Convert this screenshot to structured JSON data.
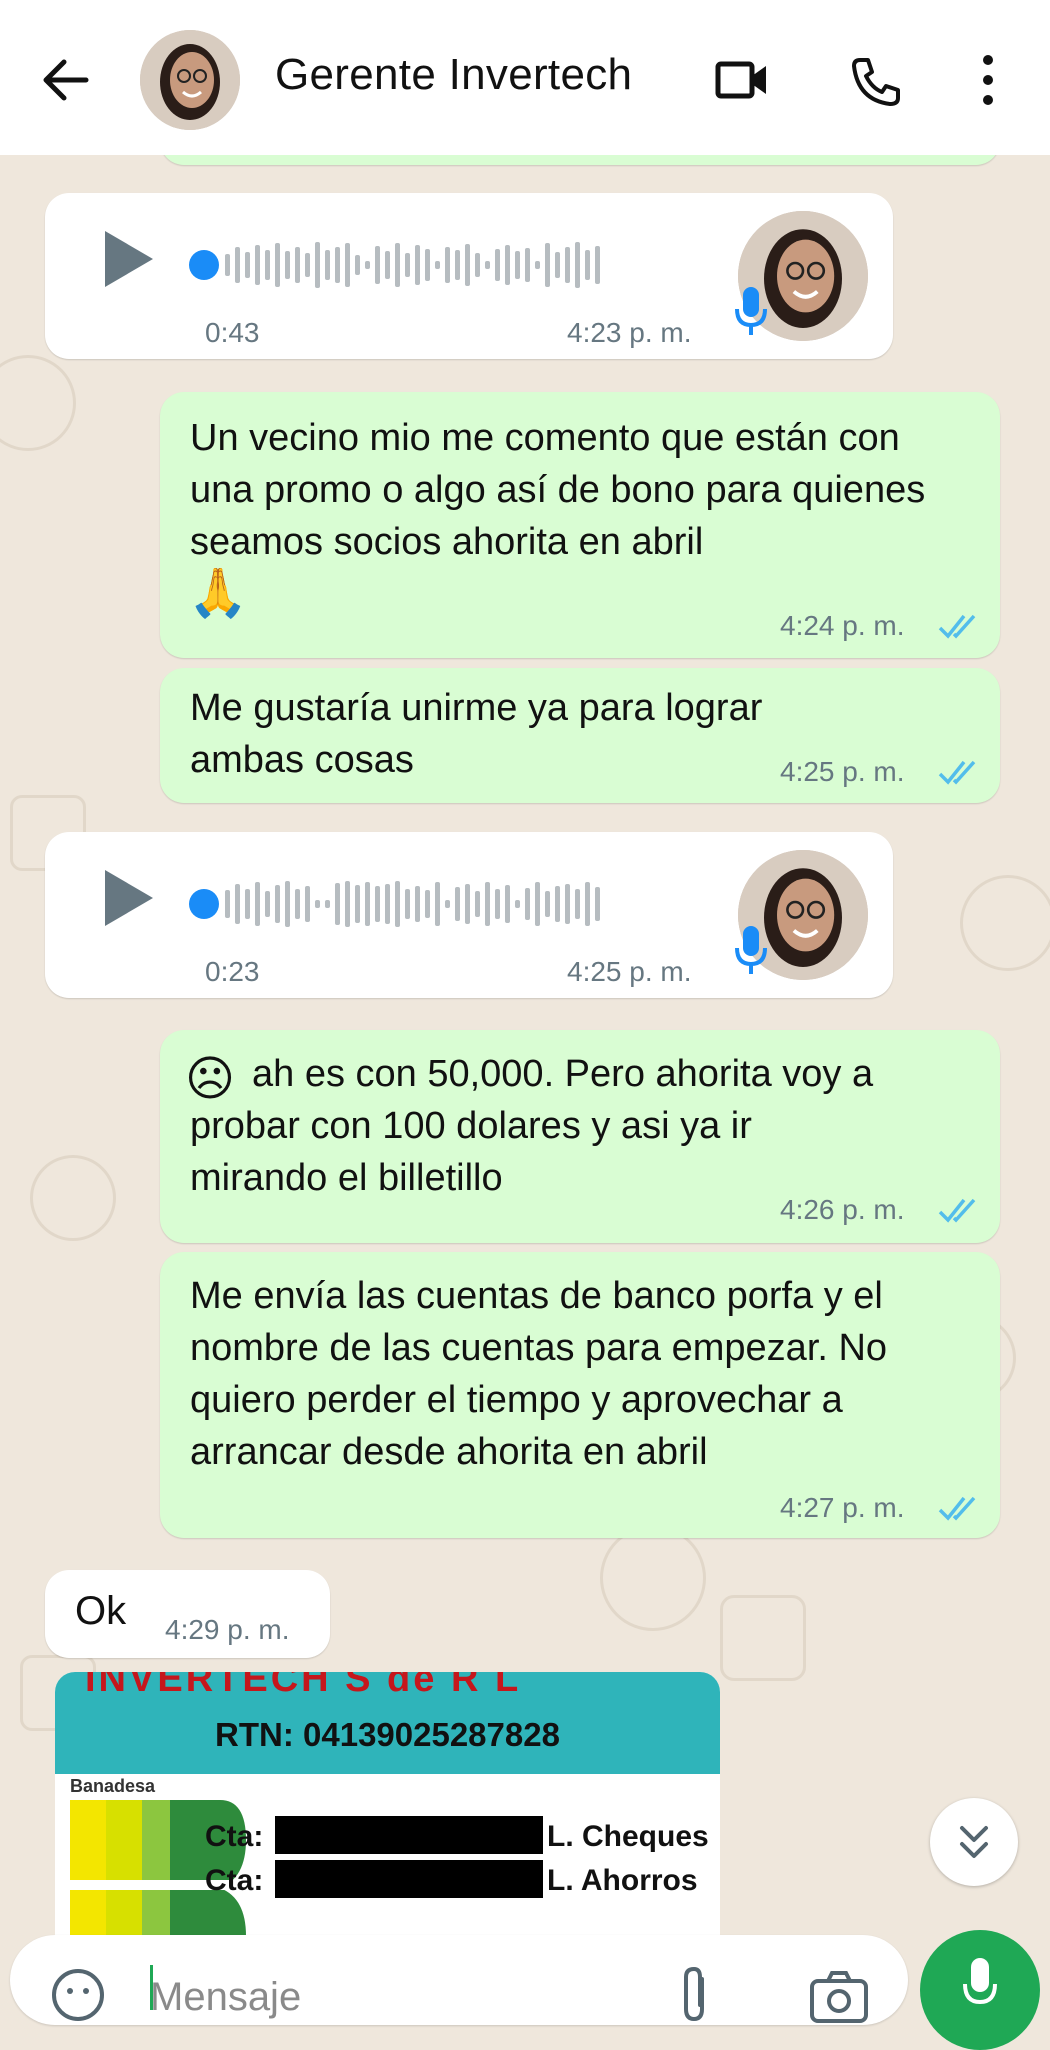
{
  "header": {
    "contact_name": "Gerente Invertech",
    "icons": [
      "back-arrow-icon",
      "video-call-icon",
      "phone-icon",
      "more-icon"
    ]
  },
  "messages": {
    "voice1": {
      "duration": "0:43",
      "time": "4:23 p. m."
    },
    "msg1": {
      "text": "Un vecino mio me comento que están con una promo o algo así de bono para quienes seamos socios ahorita en abril",
      "emoji": "🙏",
      "time": "4:24 p. m."
    },
    "msg2": {
      "text": "Me gustaría unirme ya para lograr ambas cosas",
      "time": "4:25 p. m."
    },
    "voice2": {
      "duration": "0:23",
      "time": "4:25 p. m."
    },
    "msg3": {
      "emoji": "☹",
      "text": "ah es con 50,000. Pero ahorita voy a probar con 100 dolares y asi ya ir mirando el billetillo",
      "time": "4:26 p. m."
    },
    "msg4": {
      "text": "Me envía las cuentas de banco porfa y el nombre de las cuentas para empezar. No quiero perder el tiempo y aprovechar a arrancar desde ahorita en abril",
      "time": "4:27 p. m."
    },
    "msg5": {
      "text": "Ok",
      "time": "4:29 p. m."
    }
  },
  "bank_image": {
    "company": "INVERTECH S de R L",
    "rtn": "RTN: 04139025287828",
    "bank_name": "Banadesa",
    "accounts": [
      {
        "label": "Cta:",
        "type": "L. Cheques"
      },
      {
        "label": "Cta:",
        "type": "L.  Ahorros"
      }
    ]
  },
  "input": {
    "placeholder": "Mensaje"
  },
  "colors": {
    "outgoing": "#d9fdd3",
    "incoming": "#ffffff",
    "accent": "#1fa855",
    "read_ticks": "#53bdeb"
  }
}
